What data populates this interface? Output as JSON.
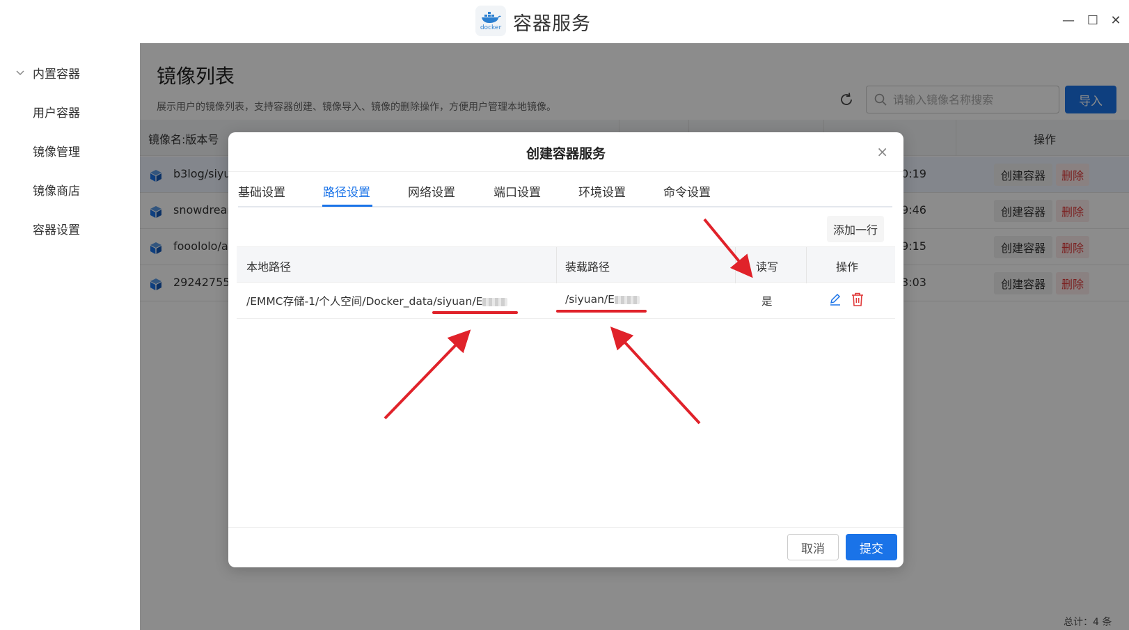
{
  "window": {
    "title": "容器服务",
    "logo_text": "docker",
    "minimize_glyph": "—",
    "maximize_glyph": "☐",
    "close_glyph": "✕"
  },
  "sidebar": {
    "items": [
      {
        "label": "内置容器",
        "expanded": true,
        "icon": "chevron-down-icon"
      },
      {
        "label": "用户容器"
      },
      {
        "label": "镜像管理"
      },
      {
        "label": "镜像商店"
      },
      {
        "label": "容器设置"
      }
    ]
  },
  "page": {
    "title": "镜像列表",
    "description": "展示用户的镜像列表，支持容器创建、镜像导入、镜像的删除操作，方便用户管理本地镜像。",
    "search_placeholder": "请输入镜像名称搜索",
    "import_label": "导入",
    "total": "总计：4 条"
  },
  "image_list": {
    "headers": {
      "name": "镜像名:版本号",
      "actions": "操作"
    },
    "rows": [
      {
        "name": "b3log/siyua",
        "time": "0:19",
        "create": "创建容器",
        "delete": "删除",
        "selected": true
      },
      {
        "name": "snowdrean",
        "time": "9:46",
        "create": "创建容器",
        "delete": "删除"
      },
      {
        "name": "fooololo/ai",
        "time": "9:15",
        "create": "创建容器",
        "delete": "删除"
      },
      {
        "name": "29242755",
        "time": "3:03",
        "create": "创建容器",
        "delete": "删除"
      }
    ]
  },
  "dialog": {
    "title": "创建容器服务",
    "close_glyph": "×",
    "tabs": [
      "基础设置",
      "路径设置",
      "网络设置",
      "端口设置",
      "环境设置",
      "命令设置"
    ],
    "active_tab": "路径设置",
    "add_row_label": "添加一行",
    "table": {
      "headers": {
        "local": "本地路径",
        "mount": "装载路径",
        "rw": "读写",
        "ops": "操作"
      },
      "rows": [
        {
          "local": "/EMMC存储-1/个人空间/Docker_data/siyuan/E",
          "mount": "/siyuan/E",
          "rw": "是"
        }
      ]
    },
    "cancel_label": "取消",
    "submit_label": "提交"
  },
  "colors": {
    "accent": "#1a73e8",
    "danger": "#e03a3a",
    "annotation": "#e0222a"
  }
}
